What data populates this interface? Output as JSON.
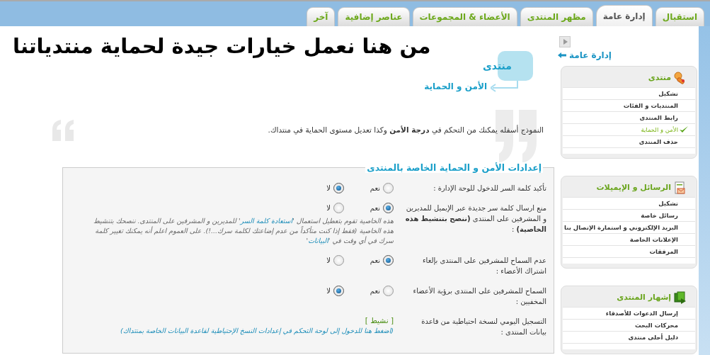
{
  "tabs": [
    {
      "label": "استقبال",
      "selected": false
    },
    {
      "label": "إدارة عامة",
      "selected": true
    },
    {
      "label": "مظهر المنتدى",
      "selected": false
    },
    {
      "label": "الأعضاء & المجموعات",
      "selected": false
    },
    {
      "label": "عناصر إضافية",
      "selected": false
    },
    {
      "label": "آخر",
      "selected": false
    }
  ],
  "heading": "من هنا نعمل خيارات جيدة لحماية منتدياتنا",
  "breadcrumb": {
    "parent": "منتدى",
    "current": "الأمن و الحماية"
  },
  "intro": "النموذج أسفله يمكنك من التحكم في **درجة الأمن** وكذا تعديل مستوى الحماية في منتداك.",
  "form": {
    "legend": "إعدادات الأمن و الحماية الخاصة بالمنتدى",
    "rows": [
      {
        "kind": "radio",
        "label": "تأكيد كلمة السر للدخول للوحة الإدارة :",
        "options": [
          {
            "label": "نعم",
            "selected": false
          },
          {
            "label": "لا",
            "selected": true
          }
        ]
      },
      {
        "kind": "radio",
        "label": "منع ارسال كلمة سر جديدة عبر الإيميل للمديرين و المشرفين على المنتدى **(ننصح بتنشيط هذه الخاصية)** :",
        "options": [
          {
            "label": "نعم",
            "selected": true
          },
          {
            "label": "لا",
            "selected": false
          }
        ],
        "description": [
          {
            "kind": "text",
            "text": "هذه الخاصية تقوم بتعطيل استعمال '"
          },
          {
            "kind": "link",
            "text": "استعادة كلمة السر"
          },
          {
            "kind": "text",
            "text": "' للمديرين و المشرفين على المنتدى. ننصحك بتنشيط هذه الخاصية (فقط إذا كنت متأكداً من عدم إضاعتك لكلمة سرك...!). على العموم اعلم أنه يمكنك تغيير كلمة سرك في أي وقت في '"
          },
          {
            "kind": "link",
            "text": "البيانات"
          },
          {
            "kind": "text",
            "text": "'"
          }
        ]
      },
      {
        "kind": "radio",
        "label": "عدم السماح للمشرفين على المنتدى بإلغاء اشتراك الأعضاء :",
        "options": [
          {
            "label": "نعم",
            "selected": true
          },
          {
            "label": "لا",
            "selected": false
          }
        ]
      },
      {
        "kind": "radio",
        "label": "السماح للمشرفين على المنتدى برؤية الأعضاء المخفيين :",
        "options": [
          {
            "label": "نعم",
            "selected": false
          },
          {
            "label": "لا",
            "selected": true
          }
        ]
      },
      {
        "kind": "status",
        "label": "التسجيل اليومي لنسخة احتياطية من قاعدة بيانات المنتدى :",
        "value": "[ نشيط ]",
        "link": "(اضغط هنا للدخول إلى لوحة التحكم في إعدادات النسخ الإحتياطية لقاعدة البيانات الخاصة بمنتداك)"
      }
    ]
  },
  "sidebar": {
    "back_link": "إدارة عامة",
    "panels": [
      {
        "title": "منتدى",
        "items": [
          {
            "label": "تشكيل",
            "selected": false
          },
          {
            "label": "المنتديات و الفئات",
            "selected": false
          },
          {
            "label": "رابط المنتدى",
            "selected": false
          },
          {
            "label": "الأمن و الحماية",
            "selected": true
          },
          {
            "label": "حذف المنتدى",
            "selected": false
          }
        ]
      },
      {
        "title": "الرسائل و الإيميلات",
        "items": [
          {
            "label": "تشكيل",
            "selected": false
          },
          {
            "label": "رسائل خاصة",
            "selected": false
          },
          {
            "label": "البريد الإلكتروني و استمارة الإتصال بنا",
            "selected": false
          },
          {
            "label": "الإعلانات الخاصة",
            "selected": false
          },
          {
            "label": "المرفقات",
            "selected": false
          }
        ]
      },
      {
        "title": "إشهار المنتدى",
        "items": [
          {
            "label": "إرسال الدعوات للأصدقاء",
            "selected": false
          },
          {
            "label": "محركات البحث",
            "selected": false
          },
          {
            "label": "دليل أحلى منتدى",
            "selected": false
          }
        ]
      }
    ]
  }
}
